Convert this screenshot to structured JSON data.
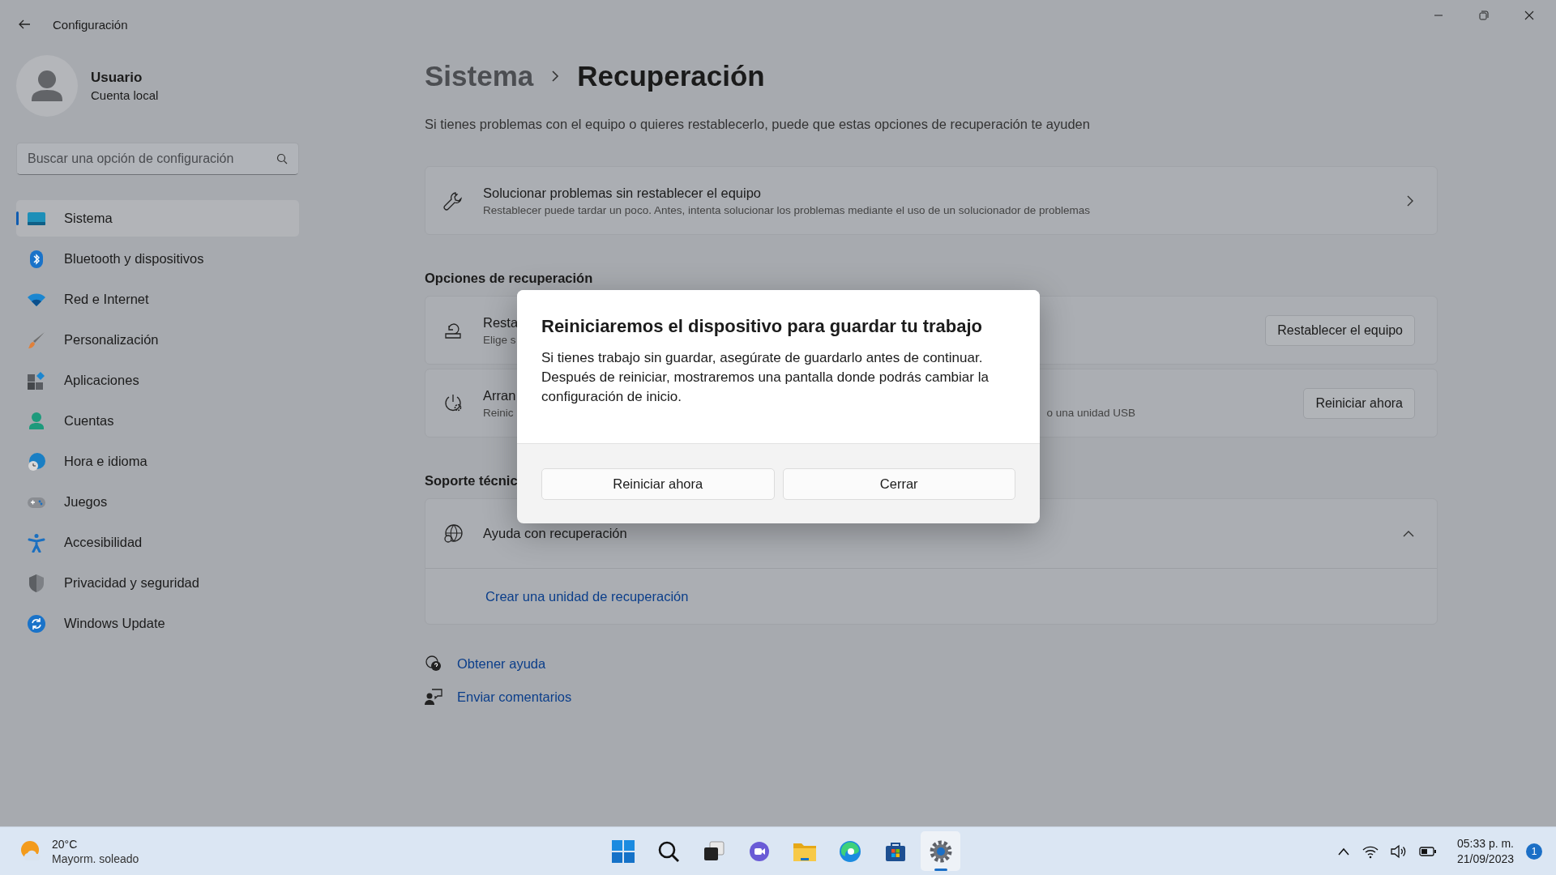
{
  "window": {
    "title": "Configuración"
  },
  "user": {
    "name": "Usuario",
    "account": "Cuenta local"
  },
  "search": {
    "placeholder": "Buscar una opción de configuración"
  },
  "sidebar": {
    "items": [
      {
        "label": "Sistema",
        "selected": true
      },
      {
        "label": "Bluetooth y dispositivos",
        "selected": false
      },
      {
        "label": "Red e Internet",
        "selected": false
      },
      {
        "label": "Personalización",
        "selected": false
      },
      {
        "label": "Aplicaciones",
        "selected": false
      },
      {
        "label": "Cuentas",
        "selected": false
      },
      {
        "label": "Hora e idioma",
        "selected": false
      },
      {
        "label": "Juegos",
        "selected": false
      },
      {
        "label": "Accesibilidad",
        "selected": false
      },
      {
        "label": "Privacidad y seguridad",
        "selected": false
      },
      {
        "label": "Windows Update",
        "selected": false
      }
    ]
  },
  "breadcrumb": {
    "parent": "Sistema",
    "current": "Recuperación"
  },
  "description": "Si tienes problemas con el equipo o quieres restablecerlo, puede que estas opciones de recuperación te ayuden",
  "troubleshoot": {
    "title": "Solucionar problemas sin restablecer el equipo",
    "subtitle": "Restablecer puede tardar un poco. Antes, intenta solucionar los problemas mediante el uso de un solucionador de problemas"
  },
  "recovery": {
    "heading": "Opciones de recuperación",
    "options": [
      {
        "title": "Resta",
        "subtitle": "Elige s",
        "button": "Restablecer el equipo"
      },
      {
        "title": "Arran",
        "subtitle": "Reinic",
        "subtitle_tail": "o una unidad USB",
        "button": "Reiniciar ahora"
      }
    ]
  },
  "support": {
    "heading": "Soporte técnic",
    "title": "Ayuda con recuperación",
    "expanded": true,
    "link": "Crear una unidad de recuperación"
  },
  "links": [
    {
      "label": "Obtener ayuda"
    },
    {
      "label": "Enviar comentarios"
    }
  ],
  "dialog": {
    "title": "Reiniciaremos el dispositivo para guardar tu trabajo",
    "body": "Si tienes trabajo sin guardar, asegúrate de guardarlo antes de continuar. Después de reiniciar, mostraremos una pantalla donde podrás cambiar la configuración de inicio.",
    "buttons": [
      "Reiniciar ahora",
      "Cerrar"
    ]
  },
  "taskbar": {
    "weather": {
      "temp": "20°C",
      "condition": "Mayorm. soleado"
    },
    "apps": [
      {
        "selected": false
      },
      {
        "selected": false
      },
      {
        "selected": false
      },
      {
        "selected": false
      },
      {
        "selected": false
      },
      {
        "selected": false
      },
      {
        "selected": false
      },
      {
        "selected": true
      }
    ],
    "time": "05:33 p. m.",
    "date": "21/09/2023",
    "notifications": "1"
  }
}
